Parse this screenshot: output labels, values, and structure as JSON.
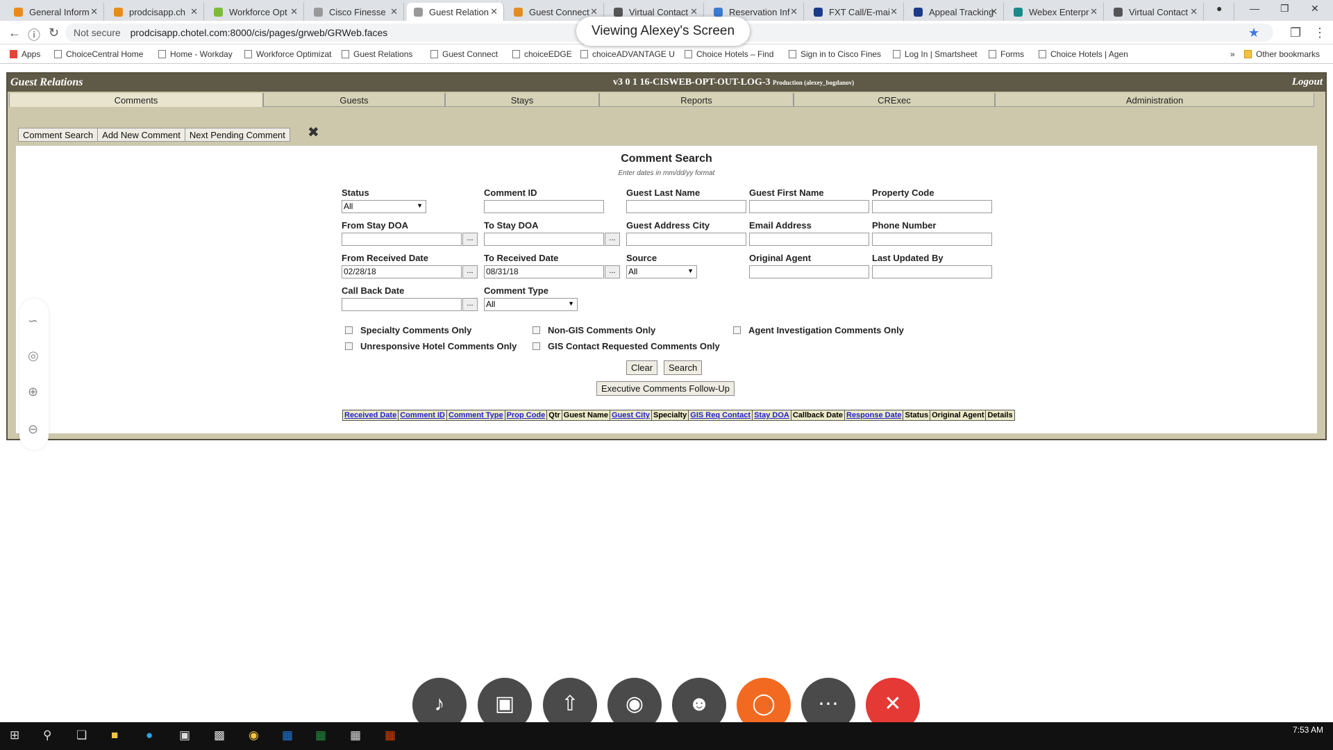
{
  "browser": {
    "tabs": [
      {
        "title": "General Inform",
        "color": "#e98b1c"
      },
      {
        "title": "prodcisapp.ch",
        "color": "#e98b1c"
      },
      {
        "title": "Workforce Opt",
        "color": "#7cbb3a"
      },
      {
        "title": "Cisco Finesse",
        "color": "#999999"
      },
      {
        "title": "Guest Relation",
        "color": "#999999"
      },
      {
        "title": "Guest Connect",
        "color": "#e98b1c"
      },
      {
        "title": "Virtual Contact",
        "color": "#555555"
      },
      {
        "title": "Reservation Inf",
        "color": "#3a7bd5"
      },
      {
        "title": "FXT Call/E-mai",
        "color": "#1b3b8a"
      },
      {
        "title": "Appeal Tracking",
        "color": "#1b3b8a"
      },
      {
        "title": "Webex Enterpr",
        "color": "#1a8a8a"
      },
      {
        "title": "Virtual Contact",
        "color": "#555555"
      }
    ],
    "active_tab": 4,
    "address": {
      "security": "Not secure",
      "url": "prodcisapp.chotel.com:8000/cis/pages/grweb/GRWeb.faces"
    },
    "bookmarks": [
      "Apps",
      "ChoiceCentral Home",
      "Home - Workday",
      "Workforce Optimizat",
      "Guest Relations",
      "Guest Connect",
      "choiceEDGE",
      "choiceADVANTAGE U",
      "Choice Hotels – Find",
      "Sign in to Cisco Fines",
      "Log In | Smartsheet",
      "Forms",
      "Choice Hotels | Agen"
    ],
    "other_bookmarks": "Other bookmarks",
    "more": "»"
  },
  "share_banner": "Viewing Alexey's Screen",
  "app": {
    "title": "Guest Relations",
    "version": "v3 0 1 16-CISWEB-OPT-OUT-LOG-3",
    "environment": "Production (alexey_bogdanov)",
    "logout": "Logout",
    "tabs": [
      "Comments",
      "Guests",
      "Stays",
      "Reports",
      "CRExec",
      "Administration"
    ],
    "sub_buttons": [
      "Comment Search",
      "Add New Comment",
      "Next Pending Comment"
    ]
  },
  "search": {
    "title": "Comment Search",
    "hint": "Enter dates in mm/dd/yy format",
    "labels": {
      "status": "Status",
      "comment_id": "Comment ID",
      "guest_last": "Guest Last Name",
      "guest_first": "Guest First Name",
      "property_code": "Property Code",
      "from_stay": "From Stay DOA",
      "to_stay": "To Stay DOA",
      "guest_city": "Guest Address City",
      "email": "Email Address",
      "phone": "Phone Number",
      "from_received": "From Received Date",
      "to_received": "To Received Date",
      "source": "Source",
      "original_agent": "Original Agent",
      "last_updated_by": "Last Updated By",
      "call_back": "Call Back Date",
      "comment_type": "Comment Type"
    },
    "values": {
      "status": "All",
      "source": "All",
      "comment_type": "All",
      "from_received": "02/28/18",
      "to_received": "08/31/18",
      "date_picker": "..."
    },
    "checkboxes": {
      "specialty": "Specialty Comments Only",
      "non_gis": "Non-GIS Comments Only",
      "agent_investigation": "Agent Investigation Comments Only",
      "unresponsive": "Unresponsive Hotel Comments Only",
      "gis_contact": "GIS Contact Requested Comments Only"
    },
    "buttons": {
      "clear": "Clear",
      "search": "Search",
      "exec_followup": "Executive Comments Follow-Up"
    }
  },
  "results_columns": [
    {
      "label": "Received Date",
      "link": true
    },
    {
      "label": "Comment ID",
      "link": true
    },
    {
      "label": "Comment Type",
      "link": true
    },
    {
      "label": "Prop Code",
      "link": true
    },
    {
      "label": "Qtr",
      "link": false
    },
    {
      "label": "Guest Name",
      "link": false
    },
    {
      "label": "Guest City",
      "link": true
    },
    {
      "label": "Specialty",
      "link": false
    },
    {
      "label": "GIS Req Contact",
      "link": true
    },
    {
      "label": "Stay DOA",
      "link": true
    },
    {
      "label": "Callback Date",
      "link": false
    },
    {
      "label": "Response Date",
      "link": true
    },
    {
      "label": "Status",
      "link": false
    },
    {
      "label": "Original Agent",
      "link": false
    },
    {
      "label": "Details",
      "link": false
    }
  ],
  "clock": "7:53 AM"
}
